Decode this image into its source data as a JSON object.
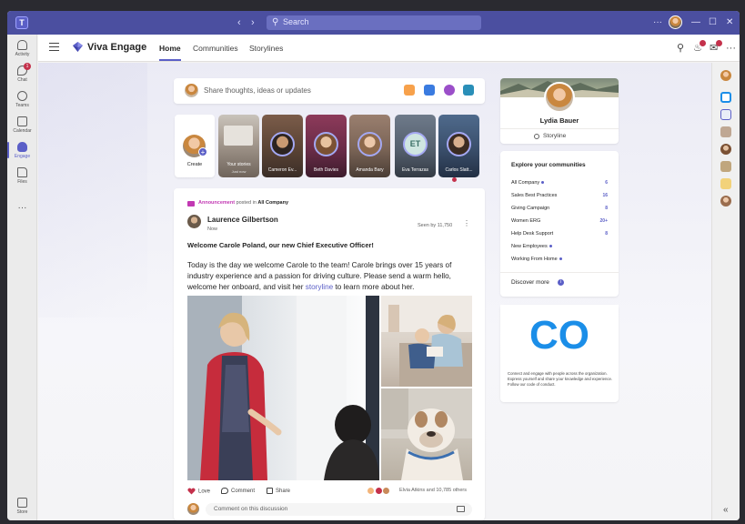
{
  "titlebar": {
    "back_icon": "chevron-left-icon",
    "forward_icon": "chevron-right-icon",
    "search_placeholder": "Search",
    "more_label": "···",
    "minimize_label": "—",
    "maximize_label": "☐",
    "close_label": "✕"
  },
  "rail": {
    "items": [
      {
        "label": "Activity",
        "icon": "bell-icon"
      },
      {
        "label": "Chat",
        "icon": "chat-icon",
        "badge": "1"
      },
      {
        "label": "Teams",
        "icon": "teams-icon"
      },
      {
        "label": "Calendar",
        "icon": "calendar-icon"
      },
      {
        "label": "Engage",
        "icon": "engage-icon"
      },
      {
        "label": "Files",
        "icon": "file-icon"
      }
    ],
    "more": "···",
    "store_label": "Store"
  },
  "header": {
    "app_title": "Viva Engage",
    "tabs": [
      "Home",
      "Communities",
      "Storylines"
    ]
  },
  "composer": {
    "placeholder": "Share thoughts, ideas or updates"
  },
  "stories": {
    "create_label": "Create",
    "items": [
      {
        "name": "Your stories",
        "sub": "Just now"
      },
      {
        "name": "Cameron Ev..."
      },
      {
        "name": "Beth Davies"
      },
      {
        "name": "Amanda Bary"
      },
      {
        "name": "Eva Terrazas",
        "initials": "ET"
      },
      {
        "name": "Carlos Slatt..."
      }
    ]
  },
  "post": {
    "tag": "Announcement",
    "posted_in_prefix": "posted in",
    "community": "All Company",
    "author": "Laurence Gilbertson",
    "time": "Now",
    "seen": "Seen by 11,750",
    "headline": "Welcome Carole Poland, our new Chief Executive Officer!",
    "body_before": "Today is the day we welcome Carole to the team! Carole brings over 15 years of industry experience and a passion for driving culture. Please send a warm hello, welcome her onboard, and visit her ",
    "body_link": "storyline",
    "body_after": " to learn more about her.",
    "actions": [
      "Love",
      "Comment",
      "Share"
    ],
    "reactions_summary": "Elvia Atkins and 10,785 others",
    "comment_placeholder": "Comment on this discussion"
  },
  "profile": {
    "name": "Lydia Bauer",
    "storyline_label": "Storyline"
  },
  "communities": {
    "title": "Explore your communities",
    "items": [
      {
        "name": "All Company",
        "dot": true,
        "count": "6"
      },
      {
        "name": "Sales Best Practices",
        "dot": false,
        "count": "16"
      },
      {
        "name": "Giving Campaign",
        "dot": false,
        "count": "8"
      },
      {
        "name": "Women ERG",
        "dot": false,
        "count": "20+"
      },
      {
        "name": "Help Desk Support",
        "dot": false,
        "count": "8"
      },
      {
        "name": "New Employees",
        "dot": true,
        "count": ""
      },
      {
        "name": "Working From Home",
        "dot": true,
        "count": ""
      }
    ],
    "discover_label": "Discover more"
  },
  "co_card": {
    "logo_text": "CO",
    "description": "Connect and engage with people across the organization. Express yourself and share your knowledge and experience. Follow our code of conduct."
  },
  "colors": {
    "accent": "#5b5fc7",
    "titlebar": "#4b4fa0",
    "announcement": "#c239b3",
    "love": "#c4314b",
    "co_logo": "#1b8ee8"
  }
}
